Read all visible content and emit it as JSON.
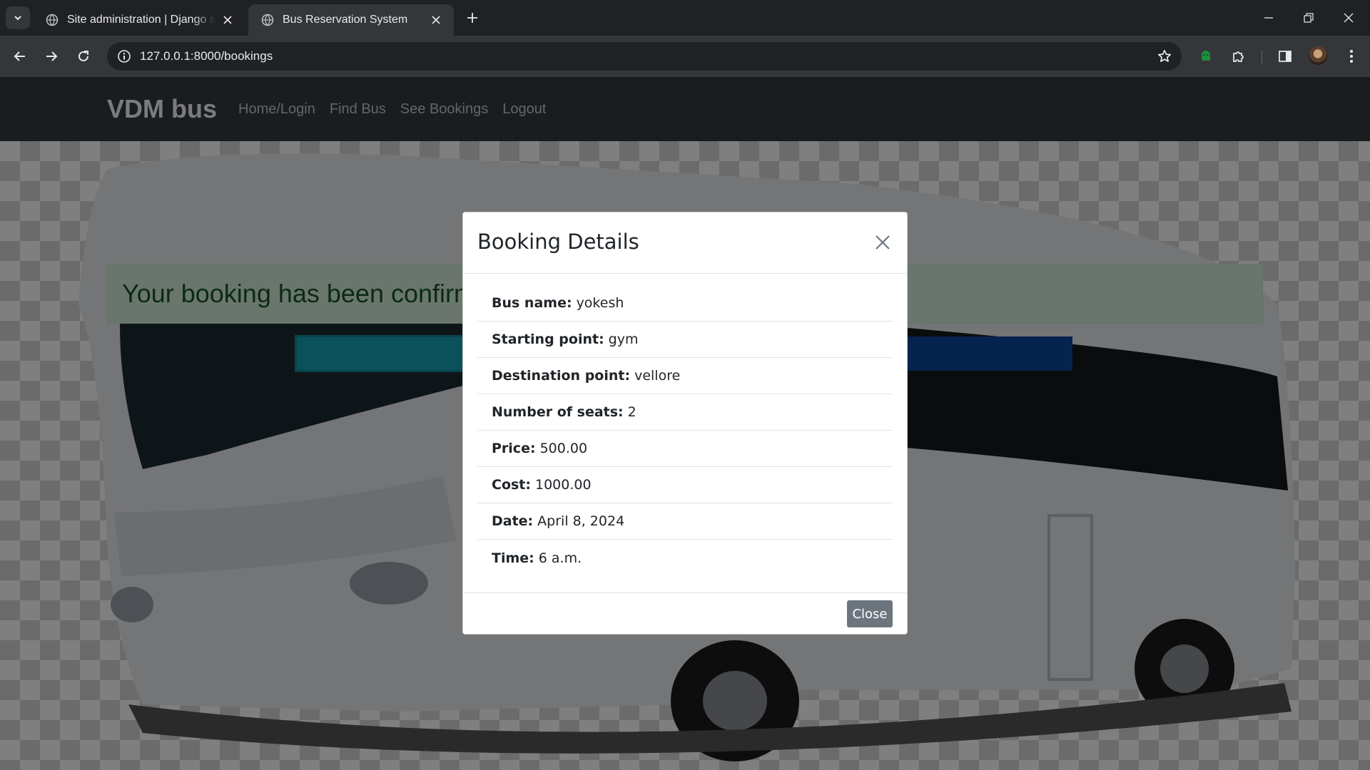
{
  "browser": {
    "tabs": [
      {
        "title": "Site administration | Django site admin",
        "active": false
      },
      {
        "title": "Bus Reservation System",
        "active": true
      }
    ],
    "url": "127.0.0.1:8000/bookings"
  },
  "navbar": {
    "brand": "VDM bus",
    "links": [
      "Home/Login",
      "Find Bus",
      "See Bookings",
      "Logout"
    ]
  },
  "page": {
    "alert": "Your booking has been confirmed"
  },
  "modal": {
    "title": "Booking Details",
    "details": [
      {
        "label": "Bus name:",
        "value": "yokesh"
      },
      {
        "label": "Starting point:",
        "value": "gym"
      },
      {
        "label": "Destination point:",
        "value": "vellore"
      },
      {
        "label": "Number of seats:",
        "value": "2"
      },
      {
        "label": "Price:",
        "value": "500.00"
      },
      {
        "label": "Cost:",
        "value": "1000.00"
      },
      {
        "label": "Date:",
        "value": "April 8, 2024"
      },
      {
        "label": "Time:",
        "value": "6 a.m."
      }
    ],
    "close_label": "Close"
  },
  "icons": {
    "tab_search": "chevron-down-icon",
    "favicon": "globe-icon",
    "tab_close": "close-icon",
    "new_tab": "plus-icon",
    "back": "arrow-left-icon",
    "forward": "arrow-right-icon",
    "reload": "reload-icon",
    "site_info": "info-icon",
    "bookmark": "star-icon",
    "extension_green": "android-icon",
    "extensions": "puzzle-icon",
    "side_panel": "side-panel-icon",
    "menu": "kebab-menu-icon"
  },
  "colors": {
    "navbar_bg": "#343a40",
    "alert_bg": "#d4edda",
    "alert_text": "#155724",
    "button_secondary": "#6c757d",
    "bar_teal": "#17a2b8",
    "bar_blue": "#0d47a1"
  }
}
